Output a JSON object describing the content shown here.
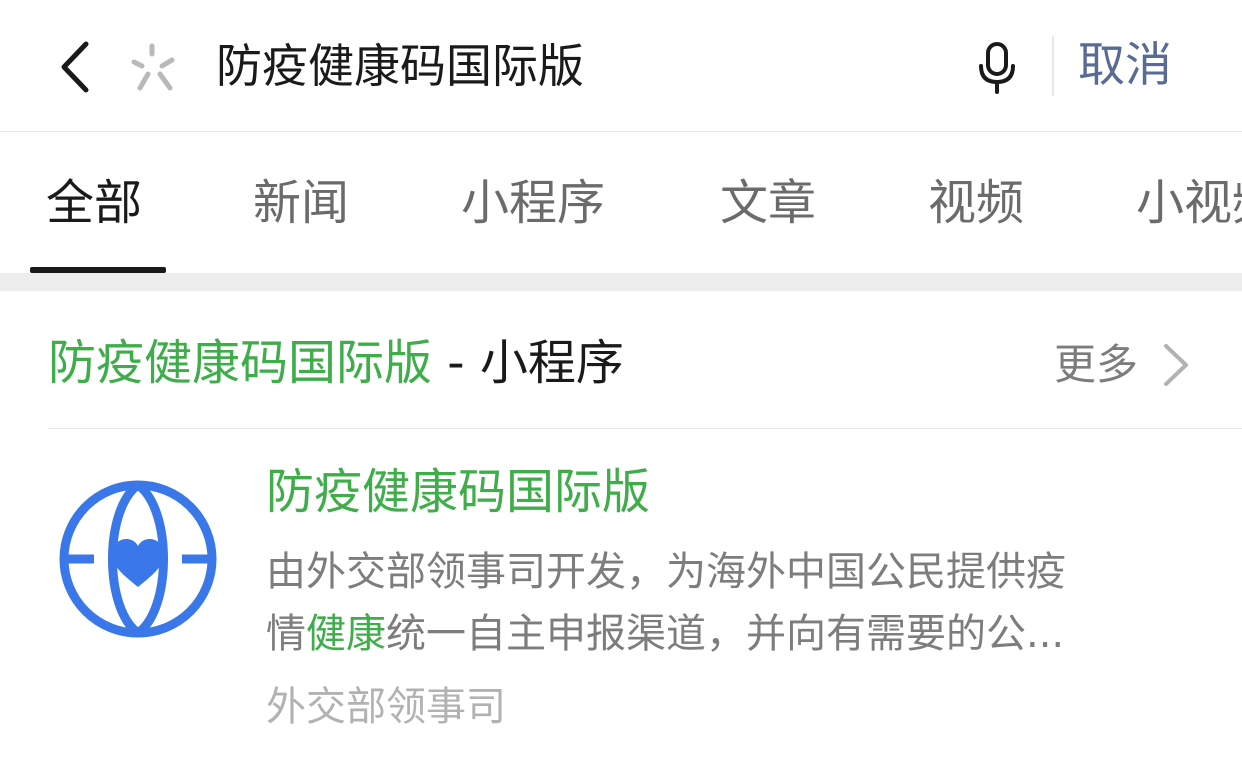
{
  "search": {
    "query": "防疫健康码国际版",
    "cancel_label": "取消"
  },
  "tabs": [
    {
      "label": "全部",
      "active": true
    },
    {
      "label": "新闻",
      "active": false
    },
    {
      "label": "小程序",
      "active": false
    },
    {
      "label": "文章",
      "active": false
    },
    {
      "label": "视频",
      "active": false
    },
    {
      "label": "小视频",
      "active": false
    }
  ],
  "section": {
    "keyword": "防疫健康码国际版",
    "type_label": " - 小程序",
    "more_label": "更多"
  },
  "result": {
    "title": "防疫健康码国际版",
    "desc_line1": "由外交部领事司开发，为海外中国公民提供疫",
    "desc_line2_prefix": "情",
    "desc_line2_highlight": "健康",
    "desc_line2_suffix": "统一自主申报渠道，并向有需要的公...",
    "source": "外交部领事司"
  },
  "colors": {
    "accent_green": "#3fad4a",
    "link_blue": "#576b95",
    "logo_blue": "#3a77e8"
  }
}
